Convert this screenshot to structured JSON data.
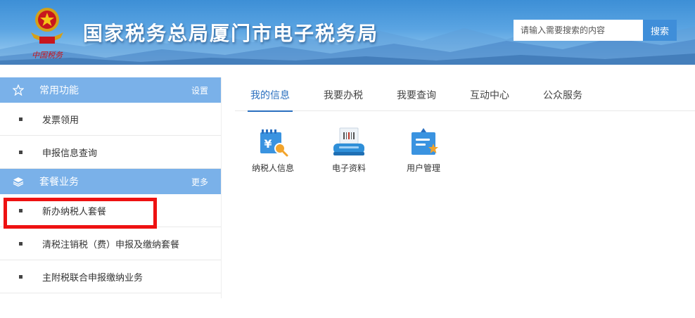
{
  "header": {
    "title": "国家税务总局厦门市电子税务局",
    "emblem_text": "中国税务",
    "search": {
      "placeholder": "请输入需要搜索的内容",
      "button_label": "搜索"
    }
  },
  "sidebar": {
    "sections": [
      {
        "title": "常用功能",
        "icon": "star-outline-icon",
        "link": "设置",
        "items": [
          {
            "label": "发票领用"
          },
          {
            "label": "申报信息查询"
          }
        ]
      },
      {
        "title": "套餐业务",
        "icon": "layers-icon",
        "link": "更多",
        "items": [
          {
            "label": "新办纳税人套餐"
          },
          {
            "label": "清税注销税（费）申报及缴纳套餐"
          },
          {
            "label": "主附税联合申报缴纳业务"
          }
        ]
      }
    ],
    "highlighted_item": "新办纳税人套餐"
  },
  "main": {
    "tabs": [
      {
        "label": "我的信息",
        "active": true
      },
      {
        "label": "我要办税",
        "active": false
      },
      {
        "label": "我要查询",
        "active": false
      },
      {
        "label": "互动中心",
        "active": false
      },
      {
        "label": "公众服务",
        "active": false
      }
    ],
    "apps": [
      {
        "label": "纳税人信息",
        "icon": "taxpayer-info-icon"
      },
      {
        "label": "电子资料",
        "icon": "scanner-icon"
      },
      {
        "label": "用户管理",
        "icon": "user-management-icon"
      }
    ]
  },
  "colors": {
    "header_blue": "#3d8fd6",
    "sidebar_header": "#7ab1e9",
    "active_tab": "#2a6fbf",
    "highlight_border": "#ee1111",
    "search_button": "#3f8ed9"
  }
}
